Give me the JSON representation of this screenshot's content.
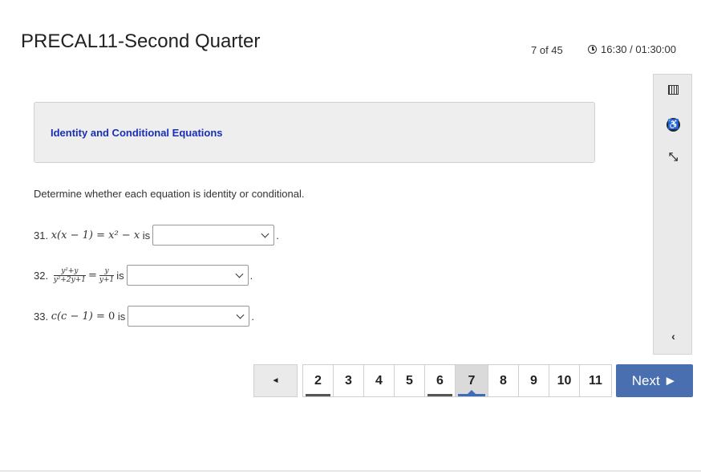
{
  "header": {
    "title": "PRECAL11-Second Quarter",
    "progress": "7 of 45",
    "timer": "16:30 / 01:30:00"
  },
  "sidebar": {
    "icons": [
      "calendar-icon",
      "accessibility-icon",
      "expand-icon",
      "chevron-left-icon"
    ]
  },
  "section": {
    "heading": "Identity and Conditional Equations"
  },
  "instructions": "Determine whether each equation is identity or conditional.",
  "questions": [
    {
      "number": "31.",
      "lhs": "x(x − 1)",
      "rhs": "x² − x",
      "is": "is",
      "end": ".",
      "selected": ""
    },
    {
      "number": "32.",
      "lhs_num": "y²+y",
      "lhs_den": "y²+2y+1",
      "eq": "=",
      "rhs_num": "y",
      "rhs_den": "y+1",
      "is": "is",
      "end": ".",
      "selected": ""
    },
    {
      "number": "33.",
      "lhs": "c(c − 1)",
      "rhs": "0",
      "is": "is",
      "end": ".",
      "selected": ""
    }
  ],
  "pagination": {
    "prev_label": "◄",
    "pages": [
      "2",
      "3",
      "4",
      "5",
      "6",
      "7",
      "8",
      "9",
      "10",
      "11"
    ],
    "current": "7",
    "answered": [
      "2",
      "6",
      "7"
    ],
    "next_label": "Next ►"
  },
  "colors": {
    "accent": "#4a6fb0",
    "heading": "#1a2fb5"
  }
}
